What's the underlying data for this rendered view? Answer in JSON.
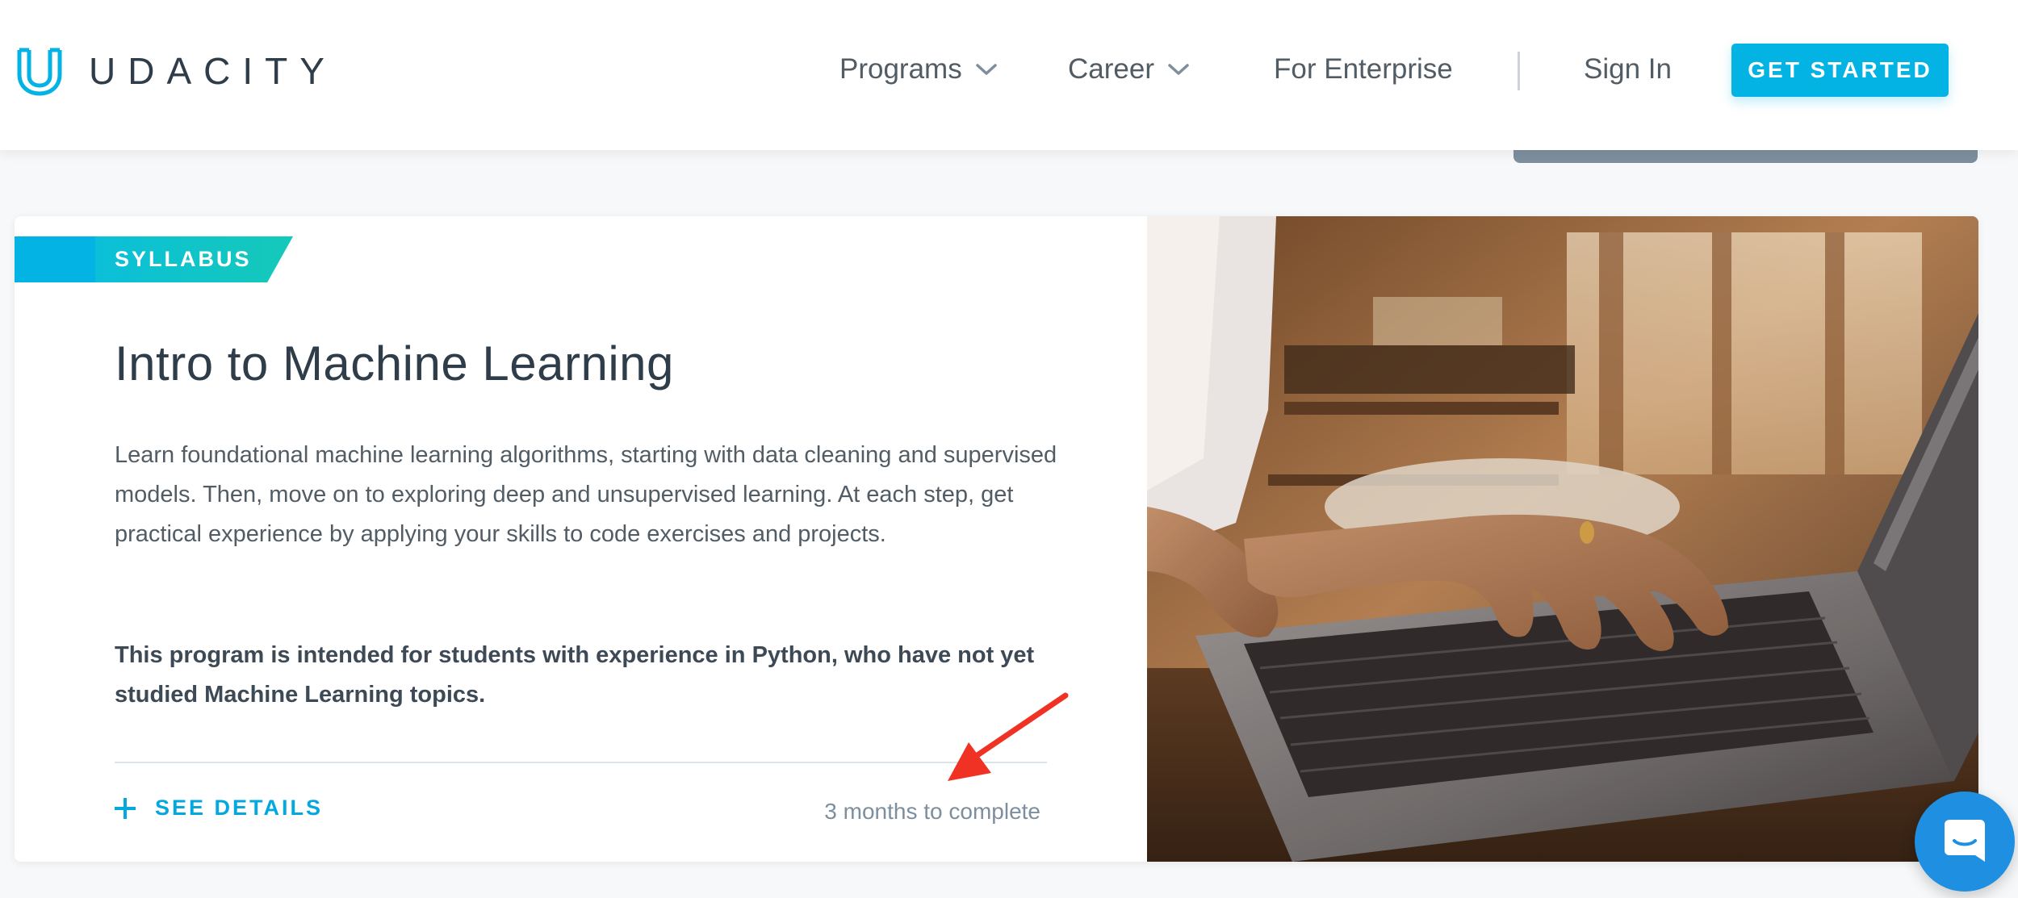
{
  "header": {
    "brand": "UDACITY",
    "nav": {
      "programs": "Programs",
      "career": "Career",
      "enterprise": "For Enterprise",
      "signin": "Sign In"
    },
    "cta": "GET STARTED"
  },
  "card": {
    "ribbon": "SYLLABUS",
    "title": "Intro to Machine Learning",
    "description": "Learn foundational machine learning algorithms, starting with data cleaning and supervised models. Then, move on to exploring deep and unsupervised learning. At each step, get practical experience by applying your skills to code exercises and projects.",
    "note": "This program is intended for students with experience in Python, who have not yet studied Machine Learning topics.",
    "see_details": "SEE DETAILS",
    "duration": "3 months to complete"
  },
  "icons": {
    "logo": "udacity-logo-icon",
    "chevron": "chevron-down-icon",
    "plus": "plus-icon",
    "arrow": "red-arrow-annotation-icon",
    "photo": "laptop-typing-photo",
    "chat": "chat-bubble-icon"
  },
  "colors": {
    "accent": "#02b3e4",
    "ribbon_start": "#0bbfd9",
    "ribbon_end": "#15c9b9",
    "annotation": "#f03224",
    "chat": "#1e8fe1"
  }
}
